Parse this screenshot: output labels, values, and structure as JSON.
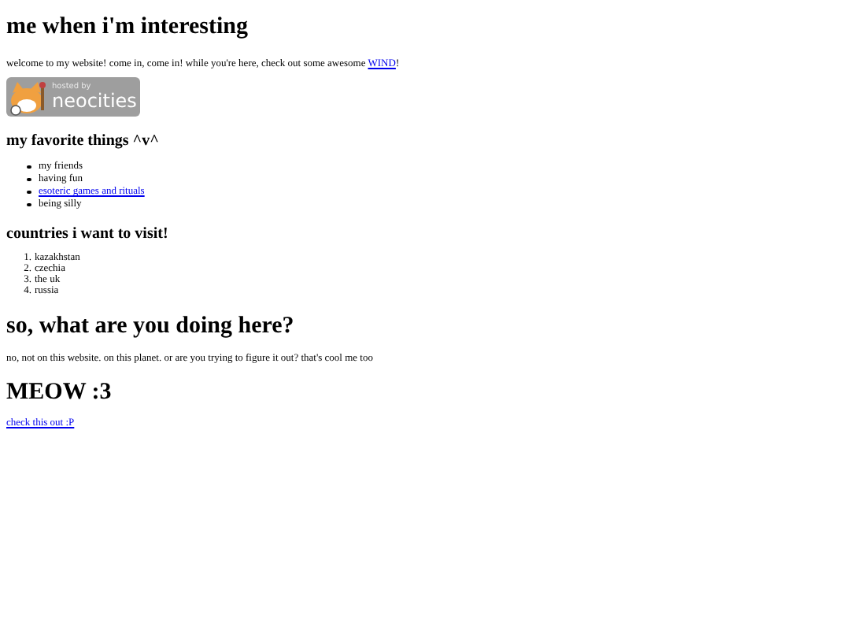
{
  "title": "me when i'm interesting",
  "intro": {
    "before": "welcome to my website! come in, come in! while you're here, check out some awesome ",
    "link": "WIND",
    "after": "!"
  },
  "badge": {
    "small": "hosted by",
    "big": "neocities"
  },
  "favorites": {
    "heading": "my favorite things ^v^",
    "items": [
      {
        "text": "my friends",
        "kind": "text"
      },
      {
        "text": "having fun",
        "kind": "text"
      },
      {
        "text": "esoteric games and rituals",
        "kind": "link"
      },
      {
        "text": "being silly",
        "kind": "text"
      }
    ]
  },
  "countries": {
    "heading": "countries i want to visit!",
    "items": [
      {
        "number": "1.",
        "text": "kazakhstan"
      },
      {
        "number": "2.",
        "text": "czechia"
      },
      {
        "number": "3.",
        "text": "the uk"
      },
      {
        "number": "4.",
        "text": "russia"
      }
    ]
  },
  "question": {
    "heading": "so, what are you doing here?",
    "text": "no, not on this website. on this planet. or are you trying to figure it out? that's cool me too"
  },
  "meow": {
    "heading": "MEOW :3",
    "link": "check this out :P"
  }
}
